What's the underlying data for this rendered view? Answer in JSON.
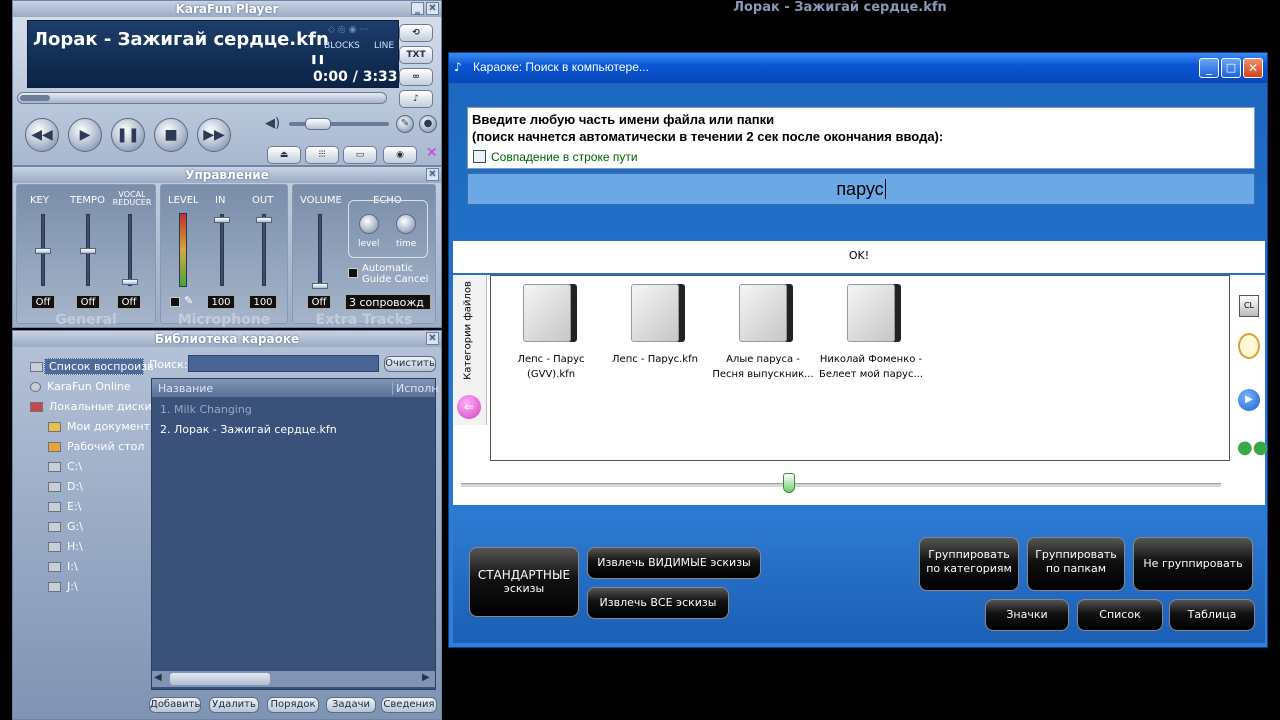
{
  "player": {
    "window_title": "KaraFun Player",
    "track_title": "Лорак - Зажигай сердце.kfn",
    "mode_blocks": "BLOCKS",
    "mode_line": "LINE",
    "time_current": "0:00",
    "time_sep": "/",
    "time_total": "3:33",
    "txt_button": "TXT",
    "seek_fraction": 0.0
  },
  "mixer": {
    "title": "Управление",
    "key": "KEY",
    "tempo": "TEMPO",
    "vocal_reducer": "VOCAL REDUCER",
    "level": "LEVEL",
    "in": "IN",
    "out": "OUT",
    "volume": "VOLUME",
    "echo": "ECHO",
    "echo_level": "level",
    "echo_time": "time",
    "automatic_guide": "Automatic Guide Cancel",
    "key_value": "Off",
    "tempo_value": "Off",
    "vocal_value": "Off",
    "in_value": "100",
    "out_value": "100",
    "volume_value": "Off",
    "accompaniment": "3 сопровожд",
    "section_general": "General",
    "section_microphone": "Microphone",
    "section_extra": "Extra Tracks"
  },
  "library": {
    "title": "Библиотека караоке",
    "search_label": "Поиск:",
    "clear_button": "Очистить",
    "col_name": "Название",
    "col_artist": "Исполн",
    "tree": [
      {
        "label": "Список воспроизв",
        "selected": true
      },
      {
        "label": "KaraFun Online"
      },
      {
        "label": "Локальные диски"
      },
      {
        "label": "Мои документ"
      },
      {
        "label": "Рабочий стол"
      },
      {
        "label": "C:\\"
      },
      {
        "label": "D:\\"
      },
      {
        "label": "E:\\"
      },
      {
        "label": "G:\\"
      },
      {
        "label": "H:\\"
      },
      {
        "label": "I:\\"
      },
      {
        "label": "J:\\"
      }
    ],
    "rows": [
      {
        "label": "1. Milk Changing",
        "dim": true
      },
      {
        "label": "2. Лорак - Зажигай сердце.kfn"
      }
    ],
    "buttons": [
      "Добавить",
      "Удалить",
      "Порядок",
      "Задачи",
      "Сведения"
    ]
  },
  "background_title": "Лорак - Зажигай сердце.kfn",
  "dialog": {
    "title": "Караоке: Поиск в компьютере...",
    "prompt_line1": "Введите любую часть имени файла или папки",
    "prompt_line2": "(поиск начнется автоматически в течении 2 сек после окончания ввода):",
    "checkbox_label": "Совпадение в строке пути",
    "search_value": "парус",
    "status": "OK!",
    "side_label": "Категории файлов",
    "results": [
      {
        "line1": "Лепс - Парус",
        "line2": "(GVV).kfn"
      },
      {
        "line1": "Лепс - Парус.kfn",
        "line2": ""
      },
      {
        "line1": "Алые паруса -",
        "line2": "Песня выпускник..."
      },
      {
        "line1": "Николай Фоменко -",
        "line2": "Белеет мой парус..."
      }
    ],
    "std_thumbs_line1": "СТАНДАРТНЫЕ",
    "std_thumbs_line2": "эскизы",
    "extract_visible": "Извлечь ВИДИМЫЕ эскизы",
    "extract_all": "Извлечь ВСЕ эскизы",
    "group_categories": "Группировать по категориям",
    "group_folders": "Группировать по папкам",
    "no_group": "Не группировать",
    "view_icons": "Значки",
    "view_list": "Список",
    "view_table": "Таблица",
    "zoom_fraction": 0.43
  }
}
